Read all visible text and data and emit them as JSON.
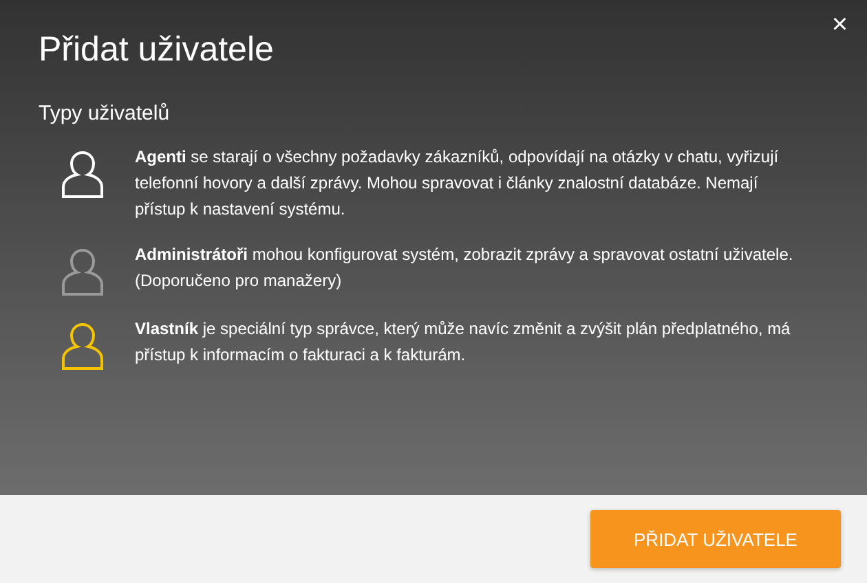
{
  "dialog": {
    "title": "Přidat uživatele",
    "close": "×"
  },
  "section_title": "Typy uživatelů",
  "user_types": [
    {
      "color": "#ffffff",
      "text": "**Agenti** se starají o všechny požadavky zákazníků, odpovídají na otázky v chatu, vyřizují telefonní hovory a další zprávy. Mohou spravovat i články znalostní databáze. Nemají přístup k nastavení systému."
    },
    {
      "color": "#9a9a9a",
      "text": "**Administrátoři** mohou konfigurovat systém, zobrazit zprávy a spravovat ostatní uživatele. (Doporučeno pro manažery)"
    },
    {
      "color": "#f5c400",
      "text": "**Vlastník** je speciální typ správce, který může navíc změnit a zvýšit plán předplatného, má přístup k informacím o fakturaci a k fakturám."
    }
  ],
  "footer": {
    "button": "PŘIDAT UŽIVATELE"
  }
}
